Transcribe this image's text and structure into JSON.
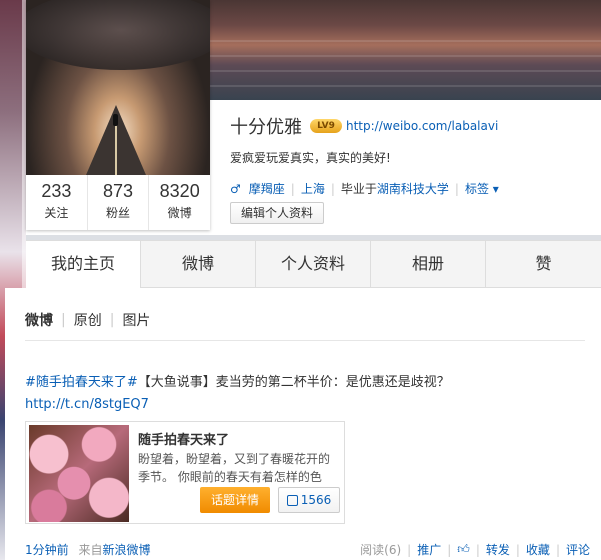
{
  "profile": {
    "nickname": "十分优雅",
    "badge": "LV9",
    "url": "http://weibo.com/labalavi",
    "bio": "爱疯爱玩爱真实，真实的美好!",
    "gender_icon": "male-icon",
    "constellation": "摩羯座",
    "location": "上海",
    "school_prefix": "毕业于",
    "school": "湖南科技大学",
    "tags": "标签 ▾",
    "edit_button": "编辑个人资料"
  },
  "stats": [
    {
      "num": "233",
      "label": "关注"
    },
    {
      "num": "873",
      "label": "粉丝"
    },
    {
      "num": "8320",
      "label": "微博"
    }
  ],
  "tabs": [
    "我的主页",
    "微博",
    "个人资料",
    "相册",
    "赞"
  ],
  "subnav": {
    "active": "微博",
    "items": [
      "原创",
      "图片"
    ]
  },
  "post": {
    "tag": "#随手拍春天来了#",
    "text": "【大鱼说事】麦当劳的第二杯半价：是优惠还是歧视？",
    "link": "http://t.cn/8stgEQ7"
  },
  "card": {
    "title": "随手拍春天来了",
    "desc": "盼望着，盼望着，又到了春暖花开的季节。 你眼前的春天有着怎样的色",
    "button": "话题详情",
    "likes": "1566"
  },
  "footer": {
    "time": "1分钟前",
    "from": "来自",
    "source": "新浪微博",
    "read": "阅读(6)",
    "promote": "推广",
    "forward": "转发",
    "collect": "收藏",
    "comment": "评论"
  },
  "colors": {
    "link": "#0a5fb5",
    "accent": "#f08b00"
  }
}
